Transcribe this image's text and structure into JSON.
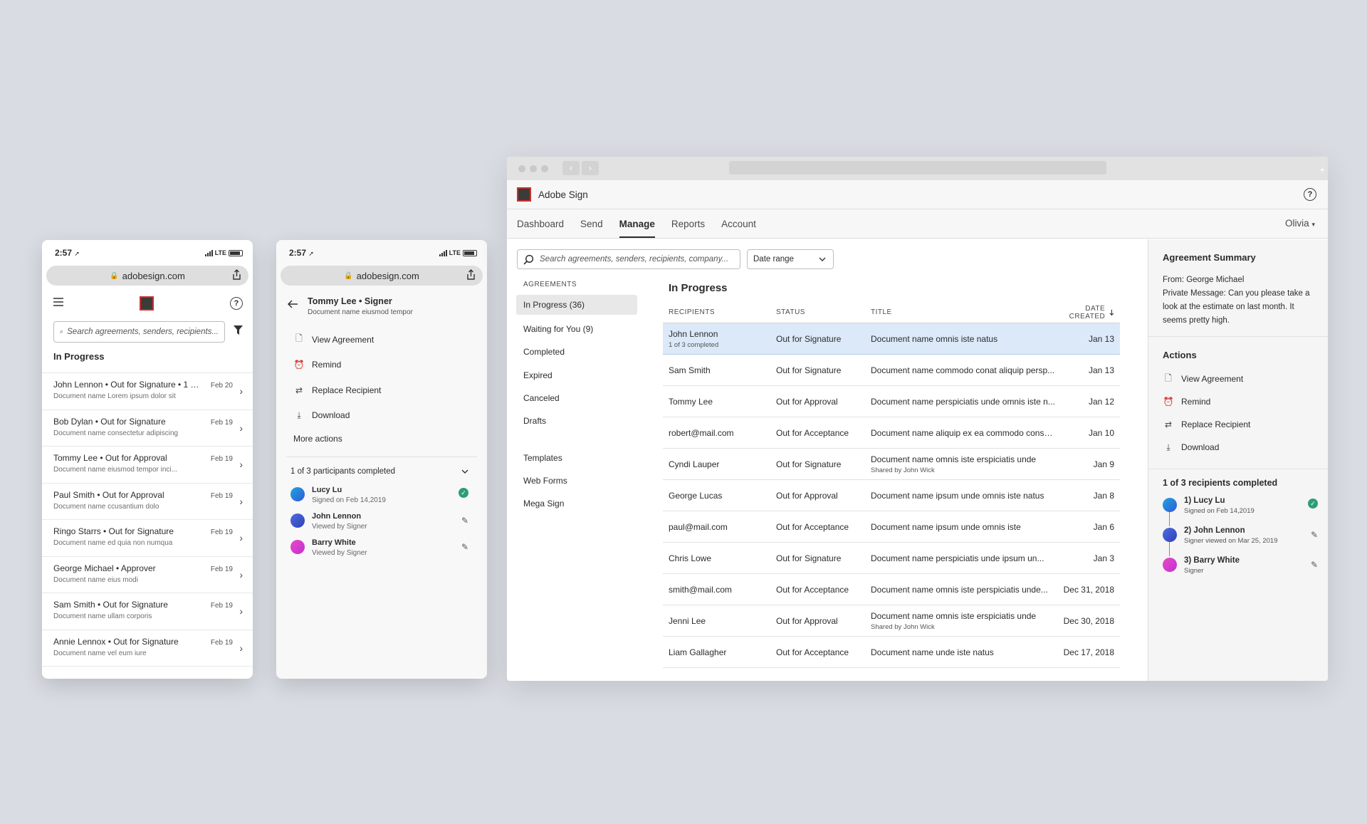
{
  "mobile_status": {
    "time": "2:57",
    "network": "LTE"
  },
  "mobile_url": "adobesign.com",
  "mobile_list": {
    "search_placeholder": "Search agreements, senders, recipients...",
    "section_title": "In Progress",
    "items": [
      {
        "title": "John Lennon • Out for Signature • 1 of 3...",
        "subtitle": "Document name Lorem ipsum dolor sit",
        "date": "Feb 20"
      },
      {
        "title": "Bob Dylan • Out for Signature",
        "subtitle": "Document name consectetur adipiscing",
        "date": "Feb 19"
      },
      {
        "title": "Tommy Lee • Out for Approval",
        "subtitle": "Document name  eiusmod tempor inci...",
        "date": "Feb 19"
      },
      {
        "title": "Paul Smith • Out for Approval",
        "subtitle": "Document name ccusantium dolo",
        "date": "Feb 19"
      },
      {
        "title": "Ringo Starrs • Out for Signature",
        "subtitle": "Document name ed quia non numqua",
        "date": "Feb 19"
      },
      {
        "title": "George Michael • Approver",
        "subtitle": "Document name eius modi",
        "date": "Feb 19"
      },
      {
        "title": "Sam Smith • Out for Signature",
        "subtitle": "Document name ullam corporis",
        "date": "Feb 19"
      },
      {
        "title": "Annie Lennox • Out for Signature",
        "subtitle": "Document name vel eum iure",
        "date": "Feb 19"
      }
    ]
  },
  "mobile_detail": {
    "title": "Tommy Lee • Signer",
    "subtitle": "Document name eiusmod tempor",
    "actions": [
      "View Agreement",
      "Remind",
      "Replace Recipient",
      "Download"
    ],
    "more_actions": "More actions",
    "participants_header": "1 of 3 participants completed",
    "participants": [
      {
        "name": "Lucy Lu",
        "status": "Signed on Feb 14,2019"
      },
      {
        "name": "John Lennon",
        "status": "Viewed by Signer"
      },
      {
        "name": "Barry White",
        "status": "Viewed by Signer"
      }
    ]
  },
  "desktop": {
    "brand": "Adobe Sign",
    "tabs": [
      "Dashboard",
      "Send",
      "Manage",
      "Reports",
      "Account"
    ],
    "user": "Olivia",
    "search_placeholder": "Search agreements, senders, recipients, company...",
    "date_range": "Date range",
    "nav_header": "AGREEMENTS",
    "nav_items": [
      "In Progress (36)",
      "Waiting for You (9)",
      "Completed",
      "Expired",
      "Canceled",
      "Drafts"
    ],
    "nav_items2": [
      "Templates",
      "Web Forms",
      "Mega Sign"
    ],
    "table_title": "In Progress",
    "columns": [
      "RECIPIENTS",
      "STATUS",
      "TITLE",
      "DATE CREATED"
    ],
    "rows": [
      {
        "recipient": "John Lennon",
        "recipient_sub": "1 of 3 completed",
        "status": "Out for Signature",
        "title": "Document name omnis iste natus",
        "title_sub": "",
        "date": "Jan 13"
      },
      {
        "recipient": "Sam Smith",
        "recipient_sub": "",
        "status": "Out for Signature",
        "title": "Document name commodo conat aliquip persp...",
        "title_sub": "",
        "date": "Jan 13"
      },
      {
        "recipient": "Tommy Lee",
        "recipient_sub": "",
        "status": "Out for Approval",
        "title": "Document name perspiciatis unde omnis iste n...",
        "title_sub": "",
        "date": "Jan 12"
      },
      {
        "recipient": "robert@mail.com",
        "recipient_sub": "",
        "status": "Out for Acceptance",
        "title": "Document name aliquip ex ea commodo conse...",
        "title_sub": "",
        "date": "Jan 10"
      },
      {
        "recipient": "Cyndi Lauper",
        "recipient_sub": "",
        "status": "Out for Signature",
        "title": "Document name omnis iste erspiciatis unde",
        "title_sub": "Shared by John Wick",
        "date": "Jan 9"
      },
      {
        "recipient": "George Lucas",
        "recipient_sub": "",
        "status": "Out for Approval",
        "title": "Document name ipsum unde omnis iste natus",
        "title_sub": "",
        "date": "Jan 8"
      },
      {
        "recipient": "paul@mail.com",
        "recipient_sub": "",
        "status": "Out for Acceptance",
        "title": "Document name ipsum unde omnis iste",
        "title_sub": "",
        "date": "Jan 6"
      },
      {
        "recipient": "Chris Lowe",
        "recipient_sub": "",
        "status": "Out for Signature",
        "title": "Document name perspiciatis unde ipsum un...",
        "title_sub": "",
        "date": "Jan 3"
      },
      {
        "recipient": "smith@mail.com",
        "recipient_sub": "",
        "status": "Out for Acceptance",
        "title": "Document name omnis iste perspiciatis unde...",
        "title_sub": "",
        "date": "Dec 31, 2018"
      },
      {
        "recipient": "Jenni Lee",
        "recipient_sub": "",
        "status": "Out for Approval",
        "title": "Document name omnis iste erspiciatis unde",
        "title_sub": "Shared by John Wick",
        "date": "Dec 30, 2018"
      },
      {
        "recipient": "Liam Gallagher",
        "recipient_sub": "",
        "status": "Out for Acceptance",
        "title": "Document name unde iste natus",
        "title_sub": "",
        "date": "Dec 17, 2018"
      }
    ],
    "summary": {
      "title": "Agreement Summary",
      "from": "From: George Michael",
      "message": "Private Message: Can you please take a look at the estimate on last month. It seems pretty high.",
      "actions_title": "Actions",
      "actions": [
        "View Agreement",
        "Remind",
        "Replace Recipient",
        "Download"
      ],
      "recipients_header": "1 of 3 recipients completed",
      "recipients": [
        {
          "name": "1) Lucy Lu",
          "status": "Signed on Feb 14,2019"
        },
        {
          "name": "2) John Lennon",
          "status": "Signer viewed on Mar 25, 2019"
        },
        {
          "name": "3) Barry White",
          "status": "Signer"
        }
      ]
    }
  },
  "colors": {
    "selected_row": "#dbe9f9",
    "complete_check": "#2d9d78",
    "logo_border": "#c9302c"
  }
}
